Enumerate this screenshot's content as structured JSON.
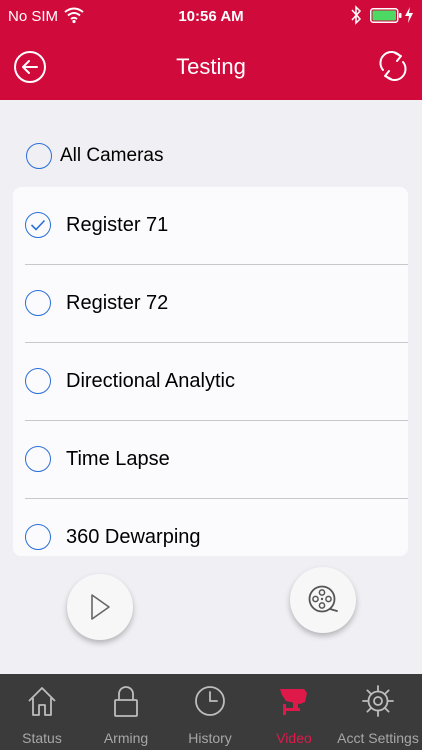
{
  "status_bar": {
    "carrier": "No SIM",
    "time": "10:56 AM"
  },
  "header": {
    "title": "Testing"
  },
  "camera_select": {
    "all_label": "All Cameras",
    "all_selected": false,
    "items": [
      {
        "label": "Register 71",
        "selected": true
      },
      {
        "label": "Register 72",
        "selected": false
      },
      {
        "label": "Directional Analytic",
        "selected": false
      },
      {
        "label": "Time Lapse",
        "selected": false
      },
      {
        "label": "360 Dewarping",
        "selected": false
      }
    ]
  },
  "tabs": [
    {
      "label": "Status",
      "icon": "home-icon",
      "active": false
    },
    {
      "label": "Arming",
      "icon": "lock-icon",
      "active": false
    },
    {
      "label": "History",
      "icon": "clock-icon",
      "active": false
    },
    {
      "label": "Video",
      "icon": "security-camera-icon",
      "active": true
    },
    {
      "label": "Acct Settings",
      "icon": "gear-icon",
      "active": false
    }
  ],
  "colors": {
    "header_bg": "#d10a3c",
    "accent_blue": "#2a6fd8",
    "tab_bar_bg": "#3b3b3b",
    "tab_active": "#e0194b",
    "tab_inactive": "#a7a7a7"
  }
}
